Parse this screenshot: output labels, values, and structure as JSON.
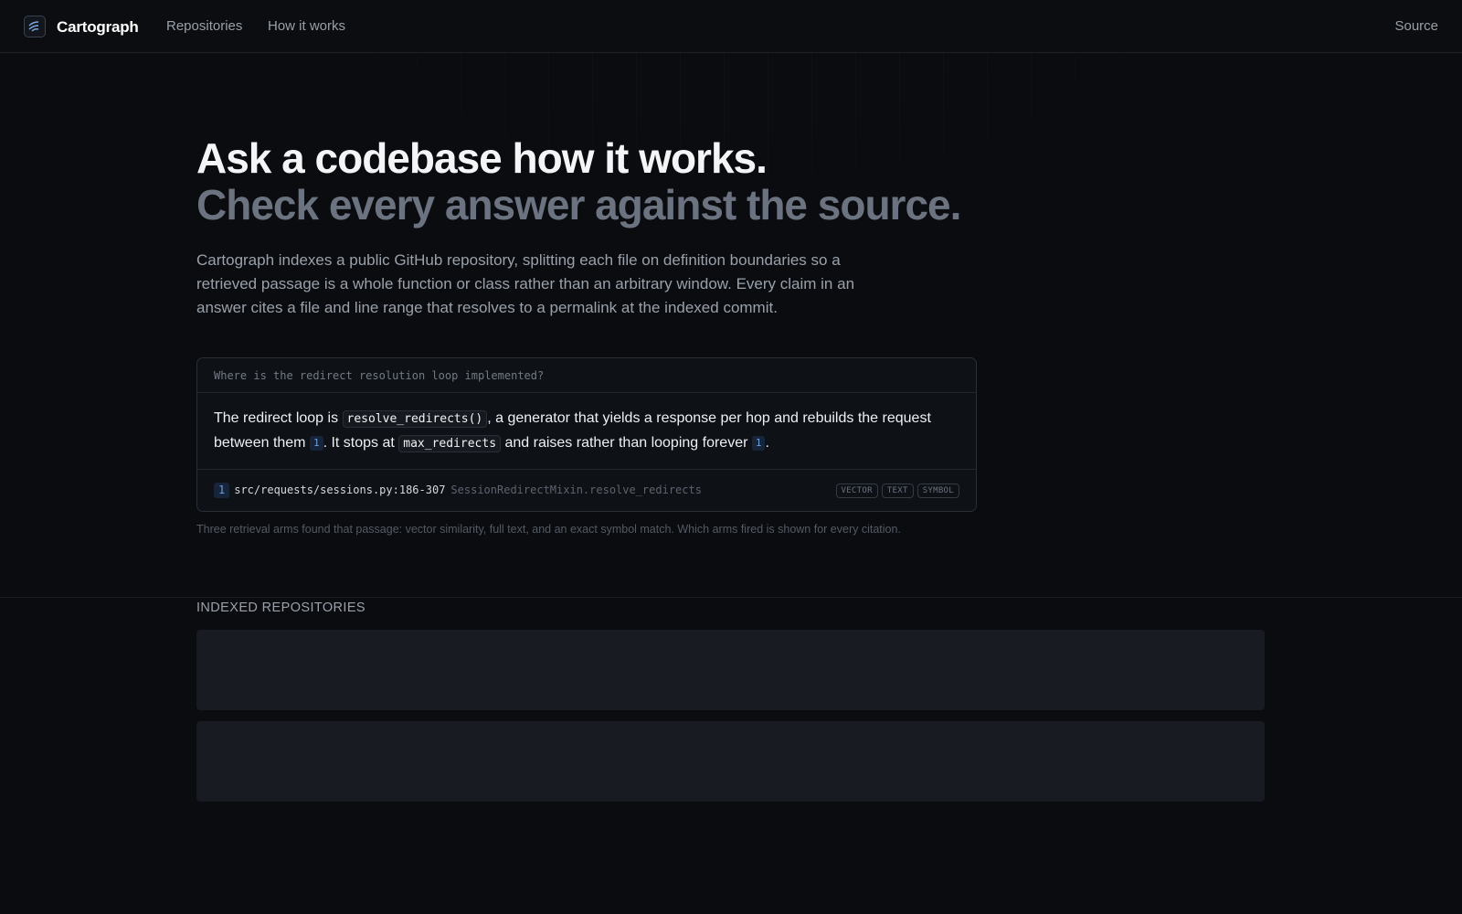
{
  "nav": {
    "brand": "Cartograph",
    "links": [
      "Repositories",
      "How it works"
    ],
    "source": "Source"
  },
  "hero": {
    "headline": "Ask a codebase how it works.",
    "subheadline": "Check every answer against the source.",
    "intro": "Cartograph indexes a public GitHub repository, splitting each file on definition boundaries so a retrieved passage is a whole function or class rather than an arbitrary window. Every claim in an answer cites a file and line range that resolves to a permalink at the indexed commit."
  },
  "example": {
    "question": "Where is the redirect resolution loop implemented?",
    "answer": {
      "t1": "The redirect loop is ",
      "code1": "resolve_redirects()",
      "t2": ", a generator that yields a response per hop and rebuilds the request between them ",
      "cite1": "1",
      "t3": ". It stops at ",
      "code2": "max_redirects",
      "t4": " and raises rather than looping forever ",
      "cite2": "1",
      "t5": "."
    },
    "source": {
      "num": "1",
      "path": "src/requests/sessions.py:186-307",
      "symbol": "SessionRedirectMixin.resolve_redirects",
      "tags": [
        "VECTOR",
        "TEXT",
        "SYMBOL"
      ]
    },
    "note": "Three retrieval arms found that passage: vector similarity, full text, and an exact symbol match. Which arms fired is shown for every citation."
  },
  "repositories": {
    "label": "INDEXED REPOSITORIES",
    "items": []
  }
}
